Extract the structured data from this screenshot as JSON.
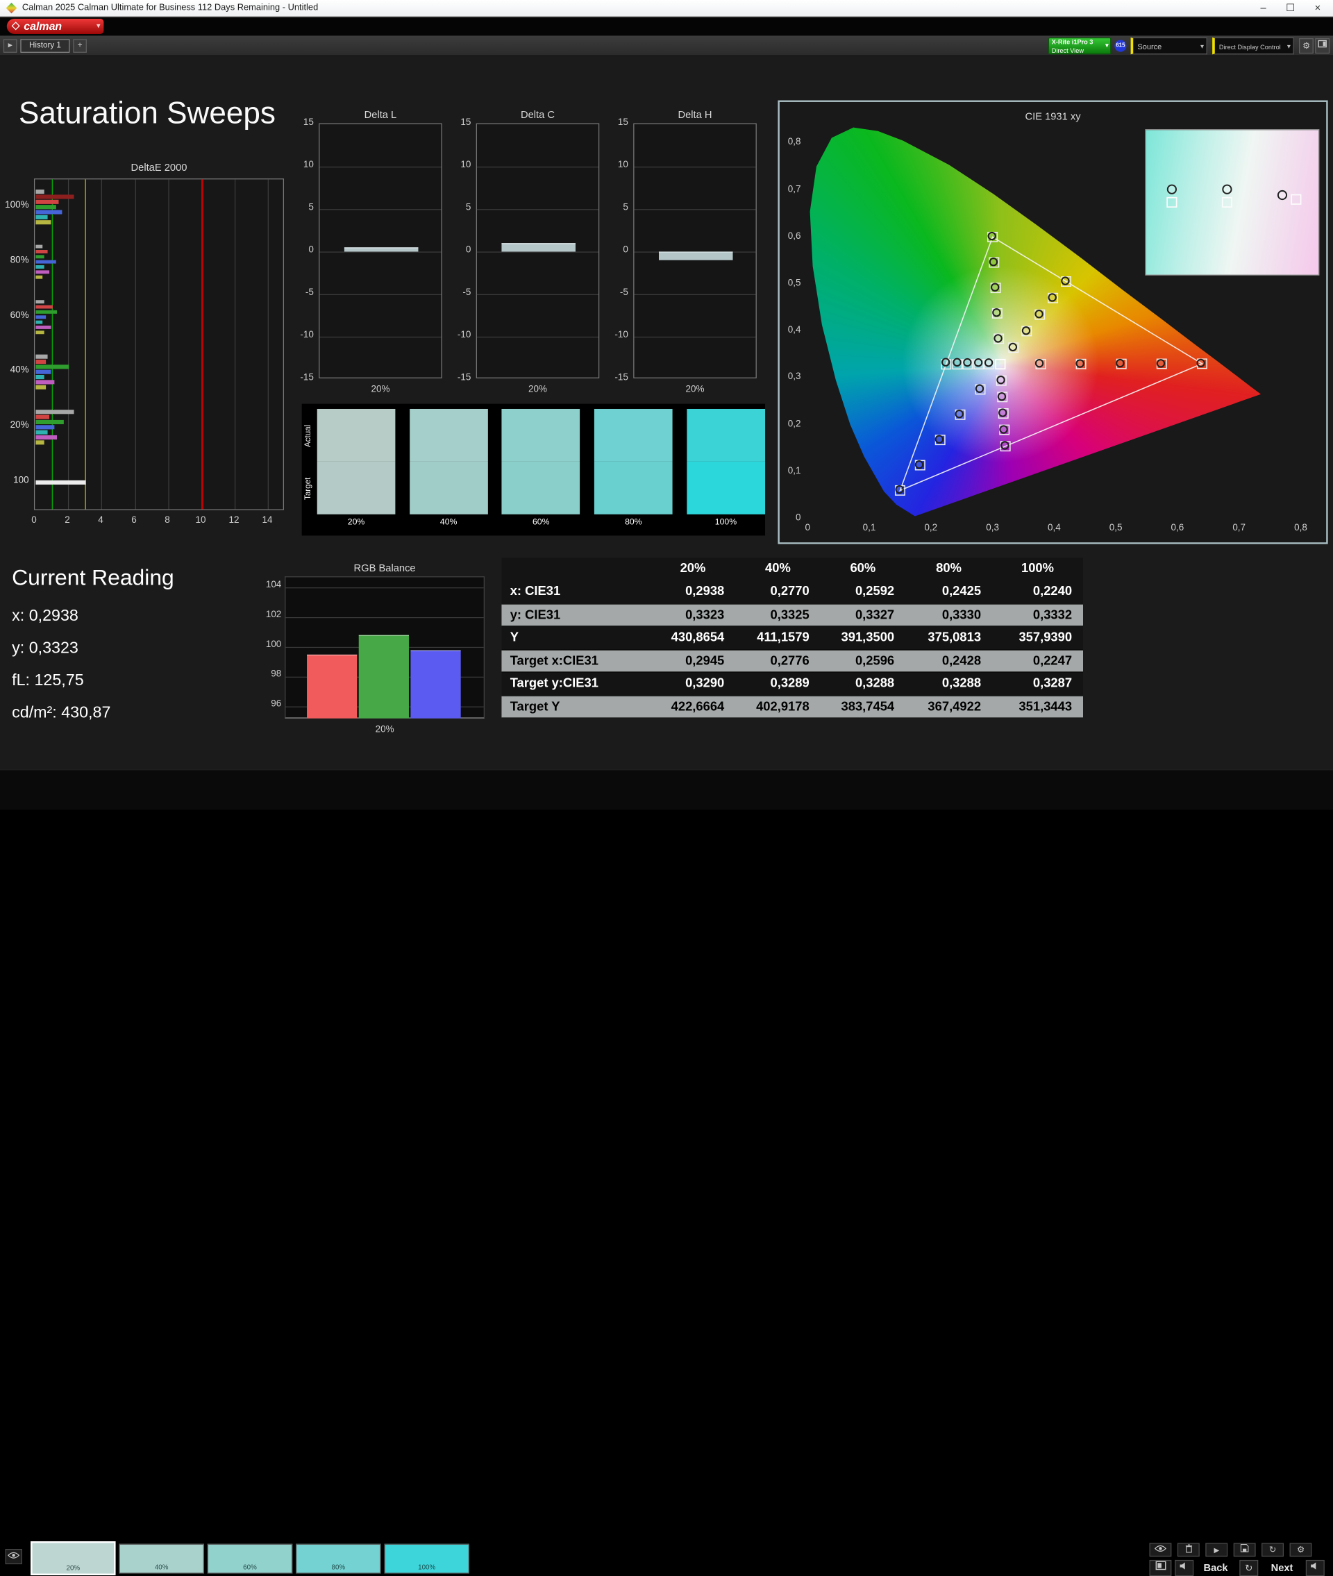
{
  "window": {
    "title": "Calman 2025 Calman Ultimate for Business 112 Days Remaining  - Untitled"
  },
  "brand": {
    "logo_text": "calman"
  },
  "icons": {
    "collapse": "▸",
    "add": "+",
    "dropdown": "▾",
    "minimize": "–",
    "maximize": "☐",
    "close": "×",
    "play": "▶",
    "repeat": "↻",
    "gear": "⚙"
  },
  "toolbar": {
    "history_tab": "History 1",
    "meter_button": {
      "line1": "X-Rite i1Pro 3",
      "line2": "Direct View"
    },
    "meter_badge": "615",
    "source_dropdown": "Source",
    "display_dropdown": "Direct Display Control"
  },
  "page": {
    "title": "Saturation Sweeps"
  },
  "current_reading": {
    "title": "Current Reading",
    "x": "x: 0,2938",
    "y": "y: 0,3323",
    "fl": "fL: 125,75",
    "cdm2": "cd/m²: 430,87"
  },
  "bottom_bar": {
    "back_label": "Back",
    "next_label": "Next",
    "swatches": [
      {
        "label": "20%",
        "color": "#bdd6d1",
        "selected": true
      },
      {
        "label": "40%",
        "color": "#a9d2cd",
        "selected": false
      },
      {
        "label": "60%",
        "color": "#92d2cd",
        "selected": false
      },
      {
        "label": "80%",
        "color": "#74d2d2",
        "selected": false
      },
      {
        "label": "100%",
        "color": "#3ed5da",
        "selected": false
      }
    ]
  },
  "colors": {
    "panel_border": "#a9bec3",
    "pass_line": "#00b400",
    "warn_line": "#c8c800",
    "fail_line": "#cc0000"
  },
  "chart_data": [
    {
      "id": "delta_e_2000",
      "type": "bar",
      "orientation": "horizontal",
      "title": "DeltaE 2000",
      "xlim": [
        0,
        15
      ],
      "xticks": [
        0,
        2,
        4,
        6,
        8,
        10,
        12,
        14
      ],
      "ref_lines": [
        {
          "value": 1,
          "color": "#00b400"
        },
        {
          "value": 3,
          "color": "#c8c800"
        },
        {
          "value": 10,
          "color": "#cc0000"
        }
      ],
      "groups": [
        {
          "label": "100%",
          "bars": [
            {
              "color": "#a8a8a8",
              "value": 0.5
            },
            {
              "color": "#8e1f1f",
              "value": 2.3
            },
            {
              "color": "#d24444",
              "value": 1.4
            },
            {
              "color": "#2f9e2f",
              "value": 1.2
            },
            {
              "color": "#4565d8",
              "value": 1.6
            },
            {
              "color": "#2fb2b2",
              "value": 0.7
            },
            {
              "color": "#b6b642",
              "value": 0.9
            }
          ]
        },
        {
          "label": "80%",
          "bars": [
            {
              "color": "#a8a8a8",
              "value": 0.4
            },
            {
              "color": "#d24444",
              "value": 0.7
            },
            {
              "color": "#2f9e2f",
              "value": 0.5
            },
            {
              "color": "#4565d8",
              "value": 1.2
            },
            {
              "color": "#2fb2b2",
              "value": 0.5
            },
            {
              "color": "#c05ec0",
              "value": 0.8
            },
            {
              "color": "#b6b642",
              "value": 0.4
            }
          ]
        },
        {
          "label": "60%",
          "bars": [
            {
              "color": "#a8a8a8",
              "value": 0.5
            },
            {
              "color": "#d24444",
              "value": 1.0
            },
            {
              "color": "#2f9e2f",
              "value": 1.3
            },
            {
              "color": "#4565d8",
              "value": 0.6
            },
            {
              "color": "#2fb2b2",
              "value": 0.4
            },
            {
              "color": "#c05ec0",
              "value": 0.9
            },
            {
              "color": "#b6b642",
              "value": 0.5
            }
          ]
        },
        {
          "label": "40%",
          "bars": [
            {
              "color": "#a8a8a8",
              "value": 0.7
            },
            {
              "color": "#d24444",
              "value": 0.6
            },
            {
              "color": "#2f9e2f",
              "value": 2.0
            },
            {
              "color": "#4565d8",
              "value": 0.9
            },
            {
              "color": "#2fb2b2",
              "value": 0.5
            },
            {
              "color": "#c05ec0",
              "value": 1.1
            },
            {
              "color": "#b6b642",
              "value": 0.6
            }
          ]
        },
        {
          "label": "20%",
          "bars": [
            {
              "color": "#a8a8a8",
              "value": 2.3
            },
            {
              "color": "#d24444",
              "value": 0.8
            },
            {
              "color": "#2f9e2f",
              "value": 1.7
            },
            {
              "color": "#4565d8",
              "value": 1.1
            },
            {
              "color": "#2fb2b2",
              "value": 0.7
            },
            {
              "color": "#c05ec0",
              "value": 1.3
            },
            {
              "color": "#b6b642",
              "value": 0.5
            }
          ]
        },
        {
          "label": "100",
          "bars": [
            {
              "color": "#ececec",
              "value": 3.0
            }
          ]
        }
      ]
    },
    {
      "id": "delta_l",
      "type": "bar",
      "title": "Delta L",
      "categories": [
        "20%"
      ],
      "values": [
        0.4
      ],
      "ylim": [
        -15,
        15
      ],
      "yticks": [
        15,
        10,
        5,
        0,
        -5,
        -10,
        -15
      ],
      "bar_color": "#b5c6c9"
    },
    {
      "id": "delta_c",
      "type": "bar",
      "title": "Delta C",
      "categories": [
        "20%"
      ],
      "values": [
        1.0
      ],
      "ylim": [
        -15,
        15
      ],
      "yticks": [
        15,
        10,
        5,
        0,
        -5,
        -10,
        -15
      ],
      "bar_color": "#b5c6c9"
    },
    {
      "id": "delta_h",
      "type": "bar",
      "title": "Delta H",
      "categories": [
        "20%"
      ],
      "values": [
        -1.0
      ],
      "ylim": [
        -15,
        15
      ],
      "yticks": [
        15,
        10,
        5,
        0,
        -5,
        -10,
        -15
      ],
      "bar_color": "#b5c6c9"
    },
    {
      "id": "rgb_balance",
      "type": "bar",
      "title": "RGB Balance",
      "categories": [
        "20%"
      ],
      "series": [
        {
          "name": "Red",
          "color": "#f25b5b",
          "values": [
            99.5
          ]
        },
        {
          "name": "Green",
          "color": "#46a846",
          "values": [
            100.8
          ]
        },
        {
          "name": "Blue",
          "color": "#5b5bf2",
          "values": [
            99.8
          ]
        }
      ],
      "ylim": [
        95,
        105
      ],
      "yticks": [
        104,
        102,
        100,
        98,
        96
      ]
    },
    {
      "id": "cie_1931_xy",
      "type": "scatter",
      "title": "CIE 1931 xy",
      "xlim": [
        0,
        0.8
      ],
      "ylim": [
        0,
        0.8
      ],
      "tick_values": [
        0,
        0.1,
        0.2,
        0.3,
        0.4,
        0.5,
        0.6,
        0.7,
        0.8
      ],
      "tick_labels": [
        "0",
        "0,1",
        "0,2",
        "0,3",
        "0,4",
        "0,5",
        "0,6",
        "0,7",
        "0,8"
      ],
      "white_point": {
        "x": 0.3127,
        "y": 0.329
      },
      "gamut_triangle": {
        "name": "sRGB",
        "red": [
          0.64,
          0.33
        ],
        "green": [
          0.3,
          0.6
        ],
        "blue": [
          0.15,
          0.06
        ]
      },
      "sweeps": [
        {
          "name": "red",
          "targets": [
            [
              0.3782,
              0.3292
            ],
            [
              0.4436,
              0.3294
            ],
            [
              0.5091,
              0.3296
            ],
            [
              0.5745,
              0.3298
            ],
            [
              0.64,
              0.33
            ]
          ],
          "measured": [
            [
              0.376,
              0.331
            ],
            [
              0.442,
              0.3305
            ],
            [
              0.507,
              0.3312
            ],
            [
              0.573,
              0.3308
            ],
            [
              0.638,
              0.3315
            ]
          ]
        },
        {
          "name": "green",
          "targets": [
            [
              0.3102,
              0.3832
            ],
            [
              0.3076,
              0.4374
            ],
            [
              0.3051,
              0.4916
            ],
            [
              0.3025,
              0.5458
            ],
            [
              0.3,
              0.6
            ]
          ],
          "measured": [
            [
              0.309,
              0.384
            ],
            [
              0.3065,
              0.439
            ],
            [
              0.304,
              0.493
            ],
            [
              0.3015,
              0.547
            ],
            [
              0.299,
              0.602
            ]
          ]
        },
        {
          "name": "blue",
          "targets": [
            [
              0.2802,
              0.2752
            ],
            [
              0.2476,
              0.2214
            ],
            [
              0.2151,
              0.1676
            ],
            [
              0.1825,
              0.1138
            ],
            [
              0.15,
              0.06
            ]
          ],
          "measured": [
            [
              0.279,
              0.277
            ],
            [
              0.246,
              0.223
            ],
            [
              0.2135,
              0.169
            ],
            [
              0.181,
              0.115
            ],
            [
              0.149,
              0.062
            ]
          ]
        },
        {
          "name": "cyan",
          "targets": [
            [
              0.2945,
              0.329
            ],
            [
              0.2776,
              0.3289
            ],
            [
              0.2596,
              0.3288
            ],
            [
              0.2428,
              0.3288
            ],
            [
              0.2247,
              0.3287
            ]
          ],
          "measured": [
            [
              0.2938,
              0.3323
            ],
            [
              0.277,
              0.3325
            ],
            [
              0.2592,
              0.3327
            ],
            [
              0.2425,
              0.333
            ],
            [
              0.224,
              0.3332
            ]
          ]
        },
        {
          "name": "magenta",
          "targets": [
            [
              0.3143,
              0.294
            ],
            [
              0.316,
              0.2591
            ],
            [
              0.3176,
              0.2241
            ],
            [
              0.3193,
              0.1892
            ],
            [
              0.3209,
              0.1542
            ]
          ],
          "measured": [
            [
              0.3135,
              0.2955
            ],
            [
              0.315,
              0.26
            ],
            [
              0.3165,
              0.2255
            ],
            [
              0.318,
              0.19
            ],
            [
              0.32,
              0.156
            ]
          ]
        },
        {
          "name": "yellow",
          "targets": [
            [
              0.334,
              0.3642
            ],
            [
              0.3553,
              0.3995
            ],
            [
              0.3767,
              0.4347
            ],
            [
              0.398,
              0.47
            ],
            [
              0.4193,
              0.5052
            ]
          ],
          "measured": [
            [
              0.333,
              0.3655
            ],
            [
              0.3545,
              0.4005
            ],
            [
              0.3755,
              0.436
            ],
            [
              0.397,
              0.4712
            ],
            [
              0.418,
              0.5065
            ]
          ]
        }
      ],
      "inset": {
        "circles": [
          [
            0.15,
            0.41
          ],
          [
            0.47,
            0.41
          ],
          [
            0.79,
            0.45
          ]
        ],
        "squares": [
          [
            0.15,
            0.5
          ],
          [
            0.47,
            0.5
          ],
          [
            0.87,
            0.48
          ]
        ]
      }
    },
    {
      "id": "saturation_table",
      "type": "table",
      "columns": [
        "20%",
        "40%",
        "60%",
        "80%",
        "100%"
      ],
      "rows": [
        {
          "label": "x: CIE31",
          "shade": "dark",
          "values": [
            "0,2938",
            "0,2770",
            "0,2592",
            "0,2425",
            "0,2240"
          ]
        },
        {
          "label": "y: CIE31",
          "shade": "light",
          "values": [
            "0,3323",
            "0,3325",
            "0,3327",
            "0,3330",
            "0,3332"
          ]
        },
        {
          "label": "Y",
          "shade": "dark",
          "values": [
            "430,8654",
            "411,1579",
            "391,3500",
            "375,0813",
            "357,9390"
          ]
        },
        {
          "label": "Target x:CIE31",
          "shade": "light",
          "values": [
            "0,2945",
            "0,2776",
            "0,2596",
            "0,2428",
            "0,2247"
          ]
        },
        {
          "label": "Target y:CIE31",
          "shade": "dark",
          "values": [
            "0,3290",
            "0,3289",
            "0,3288",
            "0,3288",
            "0,3287"
          ]
        },
        {
          "label": "Target Y",
          "shade": "light",
          "values": [
            "422,6664",
            "402,9178",
            "383,7454",
            "367,4922",
            "351,3443"
          ]
        }
      ]
    },
    {
      "id": "actual_target_swatches",
      "type": "table",
      "row_labels": [
        "Actual",
        "Target"
      ],
      "columns": [
        "20%",
        "40%",
        "60%",
        "80%",
        "100%"
      ],
      "actual_colors": [
        "#b7ccc7",
        "#a5cfca",
        "#8ed1cc",
        "#6fd1d1",
        "#3bd3d6"
      ],
      "target_colors": [
        "#b3cac6",
        "#a1cdc8",
        "#8acfca",
        "#69cfcf",
        "#2cd7dc"
      ]
    }
  ]
}
